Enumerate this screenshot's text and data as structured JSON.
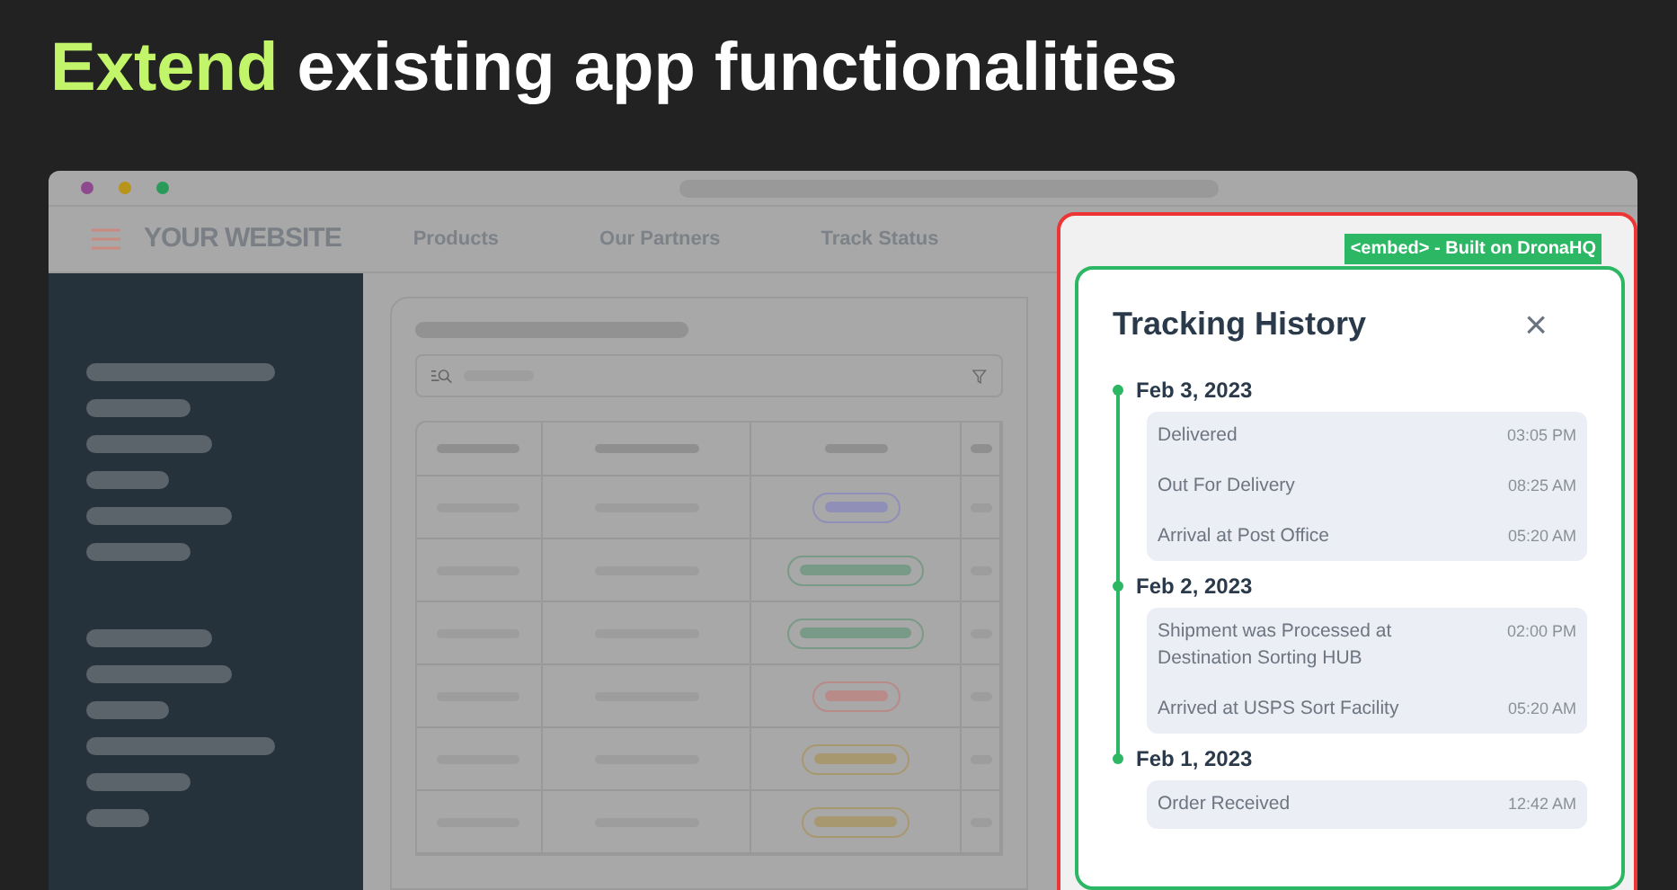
{
  "headline": {
    "highlight": "Extend",
    "rest": "existing app functionalities"
  },
  "website": {
    "brand": "YOUR WEBSITE",
    "nav": [
      "Products",
      "Our Partners",
      "Track Status"
    ]
  },
  "table": {
    "rows": [
      {
        "color": "#8f8fb8"
      },
      {
        "color": "#7a9a88"
      },
      {
        "color": "#7a9a88"
      },
      {
        "color": "#b88a88"
      },
      {
        "color": "#a89870"
      },
      {
        "color": "#a89870"
      }
    ]
  },
  "embed": {
    "tag": "<embed> - Built on DronaHQ",
    "title": "Tracking History",
    "close": "×",
    "groups": [
      {
        "date": "Feb 3, 2023",
        "events": [
          {
            "text": "Delivered",
            "time": "03:05 PM"
          },
          {
            "text": "Out For Delivery",
            "time": "08:25 AM"
          },
          {
            "text": "Arrival at Post Office",
            "time": "05:20 AM"
          }
        ]
      },
      {
        "date": "Feb 2, 2023",
        "events": [
          {
            "text": "Shipment was Processed at Destination Sorting HUB",
            "time": "02:00 PM"
          },
          {
            "text": "Arrived at USPS Sort Facility",
            "time": "05:20 AM"
          }
        ]
      },
      {
        "date": "Feb 1, 2023",
        "events": [
          {
            "text": "Order Received",
            "time": "12:42 AM"
          }
        ]
      }
    ]
  }
}
